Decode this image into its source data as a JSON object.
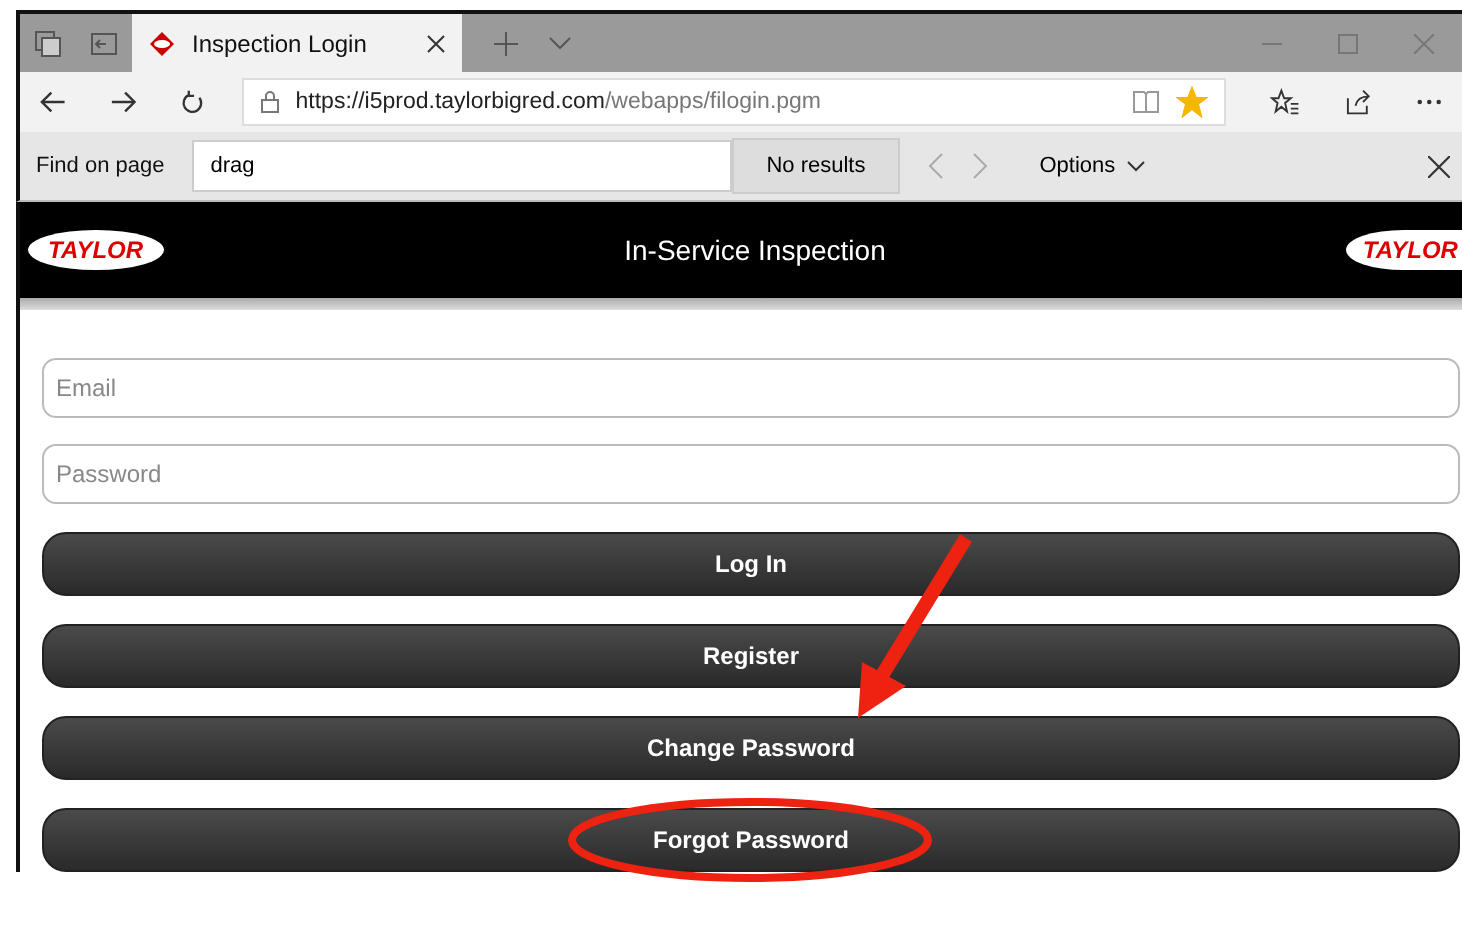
{
  "browser": {
    "tab_title": "Inspection Login",
    "url_host": "https://i5prod.taylorbigred.com",
    "url_path": "/webapps/filogin.pgm",
    "favorite": true
  },
  "find_bar": {
    "label": "Find on page",
    "query": "drag",
    "result": "No results",
    "options": "Options"
  },
  "header": {
    "logo_left": "TAYLOR",
    "title": "In-Service Inspection",
    "logo_right": "TAYLOR"
  },
  "fields": [
    {
      "placeholder": "Email"
    },
    {
      "placeholder": "Password"
    }
  ],
  "buttons": [
    {
      "label": "Log In",
      "highlighted": false
    },
    {
      "label": "Register",
      "highlighted": false
    },
    {
      "label": "Change Password",
      "highlighted": false
    },
    {
      "label": "Forgot Password",
      "highlighted": true
    }
  ]
}
